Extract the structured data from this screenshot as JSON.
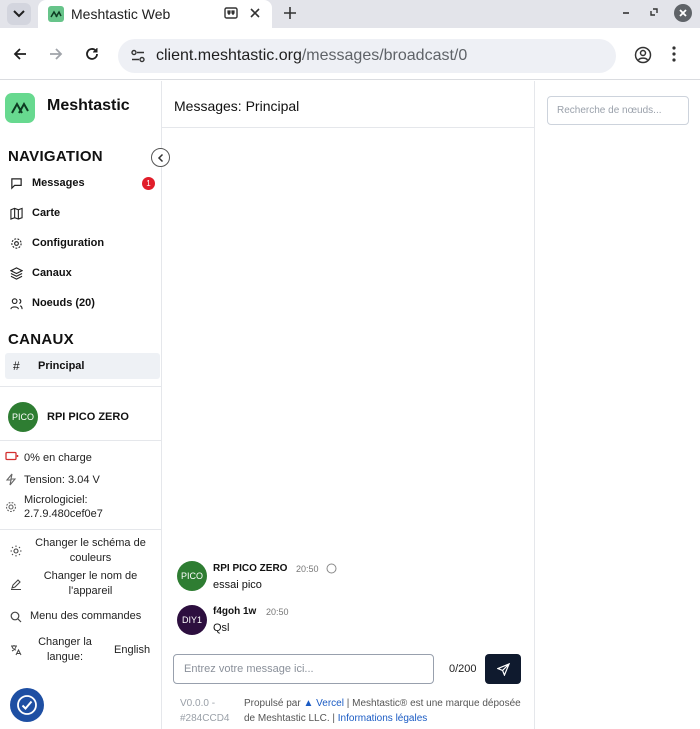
{
  "browser": {
    "tab_title": "Meshtastic Web",
    "url_host": "client.meshtastic.org",
    "url_path": "/messages/broadcast/0"
  },
  "app": {
    "name": "Meshtastic",
    "accent_color": "#67d98f"
  },
  "sidebar": {
    "nav_title": "NAVIGATION",
    "nav_items": [
      {
        "label": "Messages",
        "icon": "message-square-icon",
        "badge": "1"
      },
      {
        "label": "Carte",
        "icon": "map-icon"
      },
      {
        "label": "Configuration",
        "icon": "settings-icon"
      },
      {
        "label": "Canaux",
        "icon": "layers-icon"
      },
      {
        "label": "Noeuds (20)",
        "icon": "users-icon"
      }
    ],
    "channels_title": "CANAUX",
    "channels": [
      {
        "hash": "#",
        "label": "Principal"
      }
    ],
    "node": {
      "avatar": "PICO",
      "avatar_color": "#2e7d32",
      "name": "RPI PICO ZERO"
    },
    "stats": {
      "battery": "0% en charge",
      "voltage": "Tension: 3.04 V",
      "firmware_label": "Micrologiciel:",
      "firmware_value": "2.7.9.480cef0e7"
    },
    "actions": {
      "color_scheme": "Changer le schéma de couleurs",
      "device_name": "Changer le nom de l'appareil",
      "commands": "Menu des commandes",
      "language": "Changer la langue:",
      "language_value": "English"
    }
  },
  "main": {
    "title": "Messages: Principal",
    "messages": [
      {
        "avatar": "PICO",
        "avatar_color": "#2e7d32",
        "sender": "RPI PICO ZERO",
        "time": "20:50",
        "text": "essai pico"
      },
      {
        "avatar": "DIY1",
        "avatar_color": "#2d0f3f",
        "sender": "f4goh 1w",
        "time": "20:50",
        "text": "Qsl"
      }
    ],
    "input_placeholder": "Entrez votre message ici...",
    "char_count": "0/200"
  },
  "right_panel": {
    "search_placeholder": "Recherche de nœuds..."
  },
  "footer": {
    "version": "V0.0.0 -",
    "commit": "#284CCD4",
    "powered_prefix": "Propulsé par",
    "vercel": "Vercel",
    "trademark": "| Meshtastic® est une marque déposée de Meshtastic LLC. |",
    "legal_link": "Informations légales"
  }
}
